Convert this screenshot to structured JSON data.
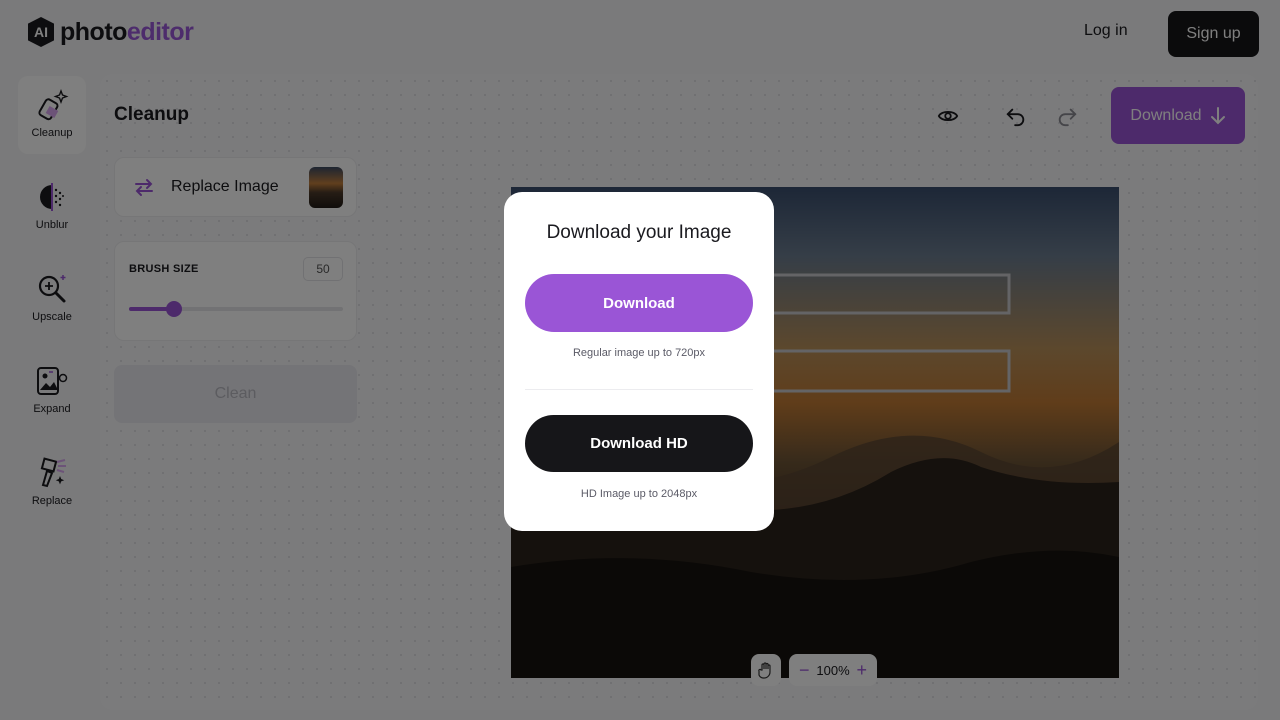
{
  "header": {
    "logo_badge": "AI",
    "logo_text_main": "photo",
    "logo_text_accent": "editor",
    "login_label": "Log in",
    "signup_label": "Sign up"
  },
  "rail": {
    "items": [
      {
        "label": "Cleanup",
        "icon": "eraser-sparkle-icon",
        "active": true
      },
      {
        "label": "Unblur",
        "icon": "unblur-icon",
        "active": false
      },
      {
        "label": "Upscale",
        "icon": "upscale-magnifier-icon",
        "active": false
      },
      {
        "label": "Expand",
        "icon": "expand-image-icon",
        "active": false
      },
      {
        "label": "Replace",
        "icon": "replace-brush-icon",
        "active": false
      }
    ]
  },
  "workspace": {
    "title": "Cleanup",
    "toolbar": {
      "preview_icon": "eye-icon",
      "undo_icon": "undo-icon",
      "redo_icon": "redo-icon",
      "download_label": "Download"
    },
    "replace_label": "Replace Image",
    "brush": {
      "label": "BRUSH SIZE",
      "value": "50",
      "fraction": 0.21
    },
    "clean_label": "Clean",
    "zoom": {
      "level": "100%",
      "minus": "−",
      "plus": "+"
    }
  },
  "modal": {
    "title": "Download your Image",
    "standard": {
      "label": "Download",
      "note": "Regular image up to 720px"
    },
    "hd": {
      "label": "Download HD",
      "note": "HD Image up to 2048px"
    }
  },
  "colors": {
    "accent": "#9a55d6",
    "dark": "#161619"
  }
}
